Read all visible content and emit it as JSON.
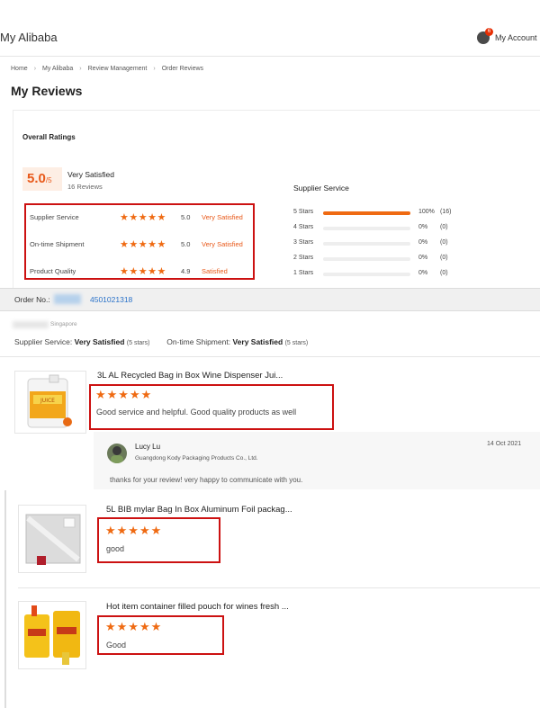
{
  "header": {
    "site_title": "My Alibaba",
    "account_label": "My Account",
    "notification_count": "6"
  },
  "breadcrumb": [
    "Home",
    "My Alibaba",
    "Review Management",
    "Order Reviews"
  ],
  "page_title": "My Reviews",
  "overall": {
    "title": "Overall Ratings",
    "score": "5.0",
    "score_suffix": "/5",
    "score_label": "Very Satisfied",
    "review_count": "16 Reviews",
    "rows": [
      {
        "label": "Supplier Service",
        "stars": "★★★★★",
        "value": "5.0",
        "text": "Very Satisfied"
      },
      {
        "label": "On-time Shipment",
        "stars": "★★★★★",
        "value": "5.0",
        "text": "Very Satisfied"
      },
      {
        "label": "Product Quality",
        "stars": "★★★★★",
        "value": "4.9",
        "text": "Satisfied"
      }
    ]
  },
  "supplier_service": {
    "title": "Supplier Service",
    "rows": [
      {
        "label": "5 Stars",
        "fill": 1.0,
        "pct": "100%",
        "count": "(16)"
      },
      {
        "label": "4 Stars",
        "fill": 0,
        "pct": "0%",
        "count": "(0)"
      },
      {
        "label": "3 Stars",
        "fill": 0,
        "pct": "0%",
        "count": "(0)"
      },
      {
        "label": "2 Stars",
        "fill": 0,
        "pct": "0%",
        "count": "(0)"
      },
      {
        "label": "1 Stars",
        "fill": 0,
        "pct": "0%",
        "count": "(0)"
      }
    ]
  },
  "order": {
    "label": "Order No.:",
    "number": "4501021318",
    "buyer_country": "Singapore",
    "supplier_service_label": "Supplier Service:",
    "supplier_service_value": "Very Satisfied",
    "supplier_service_stars": "(5 stars)",
    "shipment_label": "On-time Shipment:",
    "shipment_value": "Very Satisfied",
    "shipment_stars": "(5 stars)"
  },
  "products": [
    {
      "title": "3L AL Recycled Bag in Box Wine Dispenser Jui...",
      "stars": "★★★★★",
      "review": "Good service and helpful. Good quality products as well"
    },
    {
      "title": "5L BIB mylar Bag In Box Aluminum Foil packag...",
      "stars": "★★★★★",
      "review": "good"
    },
    {
      "title": "Hot item container filled pouch for wines fresh ...",
      "stars": "★★★★★",
      "review": "Good"
    }
  ],
  "reply": {
    "name": "Lucy Lu",
    "company": "Guangdong Kody Packaging Products Co., Ltd.",
    "date": "14 Oct 2021",
    "text": "thanks for your review! very happy to communicate with you."
  },
  "colors": {
    "accent_orange": "#ef6a12",
    "highlight_red": "#cc1111",
    "link_blue": "#2a72c9"
  }
}
